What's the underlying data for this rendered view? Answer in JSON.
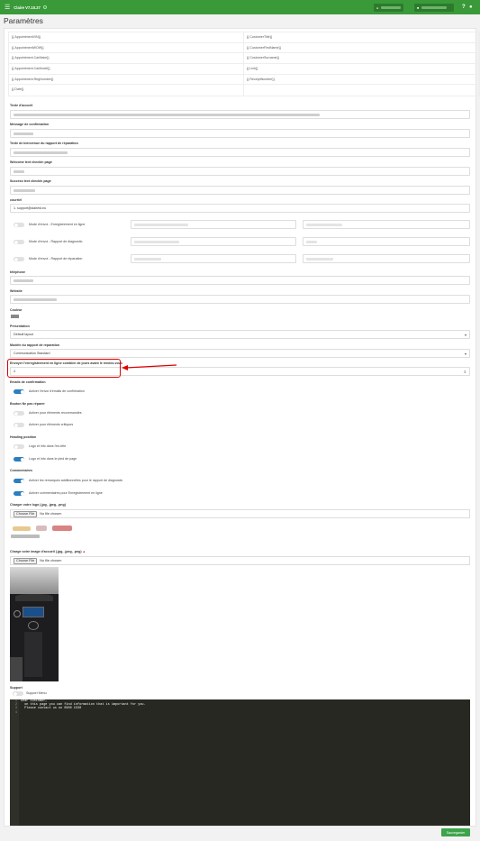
{
  "app": {
    "name": "Claire V7.10.27",
    "menu_icon": "hamburger-icon",
    "help": "?"
  },
  "page_title": "Paramètres",
  "tags": {
    "left": [
      "{{.AppointmentVIN}}",
      "{{.AppointmentWOW}}",
      "{{.Appointment.CarMake}}",
      "{{.Appointment.CarModel}}",
      "{{.Appointment.RegNumber}}",
      "{{.Date}}"
    ],
    "right": [
      "{{.CustomerTitle}}",
      "{{.CustomerFirstName}}",
      "{{.CustomerSurname}}",
      "{{.Link}}",
      "{{.ReceiptNumber}}",
      ""
    ]
  },
  "fields": {
    "welcome_text": "Texte d'accueil",
    "confirm_msg": "Message de confirmation",
    "report_text": "Texte de bienvenue du rapport de réparation",
    "checkin_text": "Welcome text checkin page",
    "success_text": "Success text checkin page",
    "email_label": "courriel",
    "email_value": "1. support@claireid.eu",
    "send_mode_1": "Mode d'envoi - Enregistrement en ligne",
    "send_mode_2": "Mode d'envoi - Rapport de diagnostic",
    "send_mode_3": "Mode d'envoi - Rapport de réparation",
    "phone_label": "téléphone",
    "website_label": "Website",
    "color_label": "Couleur",
    "presentation_label": "Présentation",
    "presentation_value": "Default layout",
    "report_model_label": "Modèle du rapport de réparation",
    "report_model_value": "Communication Standard",
    "days_label": "Envoyer l'enregistrement en ligne combien de jours avant le rendez-vous",
    "days_value": "4",
    "confirm_emails_label": "Emails de confirmation",
    "confirm_emails_toggle": "Activer l'envoi d'emails de confirmation",
    "not_repair_label": "Bouton Ne pas réparer",
    "recommended_toggle": "Activer pour éléments recommandés",
    "critical_toggle": "Activer pour éléments critiques",
    "heading_label": "Heading position",
    "logo_header_toggle": "Logo et info dans l'en-tête",
    "logo_footer_toggle": "Logo et info dans le pied de page",
    "comments_label": "Commentaires",
    "extra_remarks_toggle": "Activer les remarques additionnelles pour le rapport de diagnostic",
    "online_comments_toggle": "Activer commentaires pour Enregistrement en ligne",
    "logo_upload_label": "Charger votre logo (.jpg, .jpeg, .png)",
    "welcome_image_label": "Charge votre image d'accueil (.jpg, .jpeg, .png)",
    "choose_file": "Choose File",
    "no_file": "No file chosen",
    "support_label": "Support",
    "support_menu_toggle": "Support Menu"
  },
  "editor": {
    "lines": [
      "1",
      "2",
      "3",
      "4"
    ],
    "code": [
      "Dear customer,",
      "  on this page you can find information that is important for you.",
      "  Please contact us on 0900 1530",
      ""
    ]
  },
  "save_button": "Sauvegarder",
  "colors": {
    "brand": "#3a9a3a",
    "toggle_on": "#2a7fc0",
    "highlight": "#e00000"
  }
}
